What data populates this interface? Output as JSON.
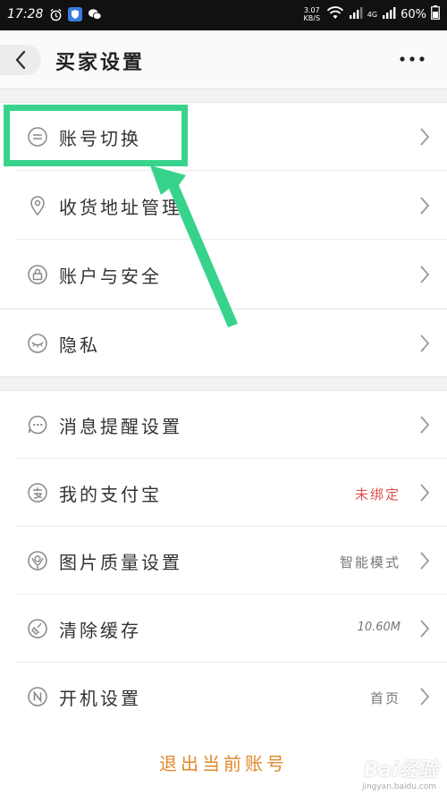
{
  "status_bar": {
    "time": "17:28",
    "net_speed_value": "3.07",
    "net_speed_unit": "KB/S",
    "net_type": "4G",
    "battery": "60%"
  },
  "header": {
    "title": "买家设置"
  },
  "group1": {
    "items": [
      {
        "label": "账号切换",
        "icon": "switch-account-icon"
      },
      {
        "label": "收货地址管理",
        "icon": "location-pin-icon"
      },
      {
        "label": "账户与安全",
        "icon": "lock-icon"
      }
    ]
  },
  "group2": {
    "items": [
      {
        "label": "隐私",
        "icon": "closed-eye-icon"
      }
    ]
  },
  "group3": {
    "items": [
      {
        "label": "消息提醒设置",
        "icon": "message-bubble-icon",
        "value": ""
      },
      {
        "label": "我的支付宝",
        "icon": "alipay-icon",
        "value": "未绑定"
      },
      {
        "label": "图片质量设置",
        "icon": "image-quality-icon",
        "value": "智能模式"
      },
      {
        "label": "清除缓存",
        "icon": "clear-cache-icon",
        "value": "10.60M"
      },
      {
        "label": "开机设置",
        "icon": "boot-setting-icon",
        "value": "首页"
      }
    ]
  },
  "footer": {
    "logout_label": "退出当前账号"
  },
  "watermark": {
    "brand": "Bai经验",
    "domain": "jingyan.baidu.com"
  },
  "colors": {
    "highlight": "#37d38c",
    "logout": "#e0892a",
    "unbound": "#d9534f"
  }
}
